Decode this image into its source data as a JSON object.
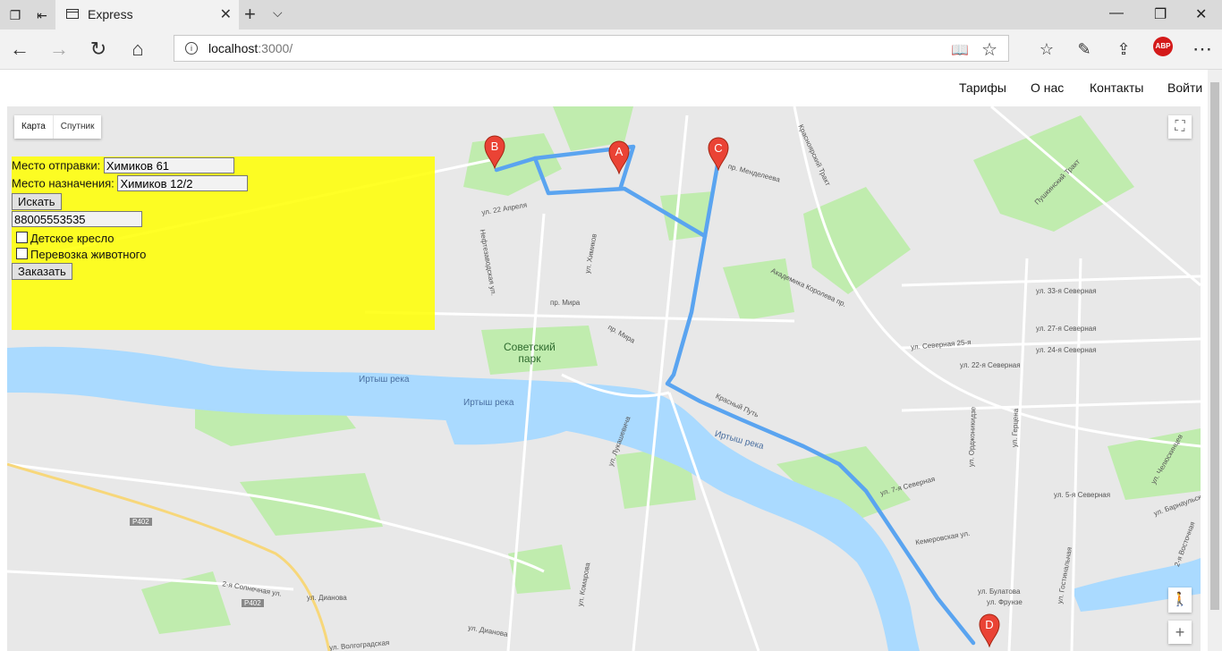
{
  "browser": {
    "tab_title": "Express",
    "url_host": "localhost",
    "url_path": ":3000/",
    "abp_label": "ABP"
  },
  "nav": {
    "items": [
      "Тарифы",
      "О нас",
      "Контакты",
      "Войти"
    ]
  },
  "map": {
    "type_buttons": [
      "Карта",
      "Спутник"
    ],
    "markers": [
      "A",
      "B",
      "C",
      "D"
    ],
    "park_label": "Советский\nпарк",
    "water_labels": [
      "Иртыш река",
      "Иртыш река",
      "Иртыш река"
    ],
    "street_labels": [
      "ул. 22 Апреля",
      "пр. Мира",
      "пр. Мира",
      "ул. Химиков",
      "Нефтезаводская ул.",
      "пр. Менделеева",
      "Академика Королева пр.",
      "ул. 33-я Северная",
      "ул. 27-я Северная",
      "ул. 24-я Северная",
      "ул. 22-я Северная",
      "ул. Северная 25-я",
      "ул. 7-я Северная",
      "ул. 5-я Северная",
      "Кемеровская ул.",
      "ул. Булатова",
      "ул. Фрунзе",
      "ул. Орджоникидзе",
      "ул. Герцена",
      "ул. Гостинальная",
      "ул. Лукашевича",
      "ул. Комарова",
      "ул. Дианова",
      "ул. Дианова",
      "2-я Солнечная ул.",
      "ул. Волгоградская",
      "Р402",
      "Р402",
      "Красный Путь",
      "Пушкинский Тракт",
      "Красноярский Тракт",
      "ул. Челюскинцев",
      "ул. Барнаульская",
      "2-я Восточная"
    ],
    "colors": {
      "route": "#5aa4f0",
      "water": "#aadaff",
      "park": "#c0ecae",
      "marker": "#ea4335"
    }
  },
  "form": {
    "from_label": "Место отправки:",
    "from_value": "Химиков 61",
    "to_label": "Место назначения:",
    "to_value": "Химиков 12/2",
    "search_label": "Искать",
    "phone_value": "88005553535",
    "child_seat_label": "Детское кресло",
    "pet_label": "Перевозка животного",
    "order_label": "Заказать"
  }
}
